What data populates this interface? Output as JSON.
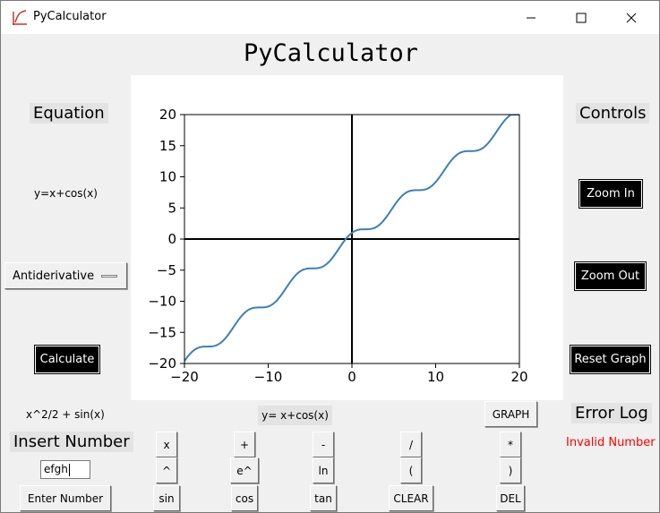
{
  "window": {
    "title": "PyCalculator"
  },
  "header": {
    "title": "PyCalculator"
  },
  "left_panel": {
    "equation_label": "Equation",
    "equation_value": "y=x+cos(x)",
    "mode_selected": "Antiderivative",
    "calculate_label": "Calculate",
    "result_value": "x^2/2 + sin(x)",
    "insert_label": "Insert Number",
    "input_value": "efgh",
    "enter_label": "Enter Number"
  },
  "right_panel": {
    "controls_label": "Controls",
    "zoom_in_label": "Zoom In",
    "zoom_out_label": "Zoom Out",
    "reset_label": "Reset Graph",
    "error_label": "Error Log",
    "error_message": "Invalid Number",
    "error_color": "#ff0000"
  },
  "graph_bar": {
    "equation_display": "y= x+cos(x)",
    "graph_label": "GRAPH"
  },
  "keypad": {
    "row1": [
      "x",
      "+",
      "-",
      "/",
      "*"
    ],
    "row2": [
      "^",
      "e^",
      "ln",
      "(",
      ")"
    ],
    "row3": [
      "sin",
      "cos",
      "tan",
      "CLEAR",
      "DEL"
    ]
  },
  "chart_data": {
    "type": "line",
    "function": "x + cos(x)",
    "xlim": [
      -20,
      20
    ],
    "ylim": [
      -20,
      20
    ],
    "x_ticks": [
      -20,
      -10,
      0,
      10,
      20
    ],
    "y_ticks": [
      -20,
      -15,
      -10,
      -5,
      0,
      5,
      10,
      15,
      20
    ],
    "grid": false,
    "line_color": "#3b80b9",
    "axis_line_color": "#000000"
  }
}
